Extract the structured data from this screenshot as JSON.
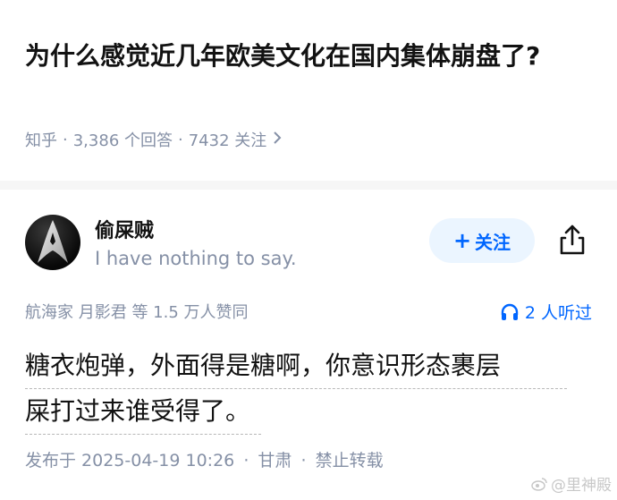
{
  "question": {
    "title": "为什么感觉近几年欧美文化在国内集体崩盘了?",
    "site": "知乎",
    "answer_count": "3,386 个回答",
    "follower_count": "7432 关注",
    "chevron_icon": "chevron-right-icon"
  },
  "author": {
    "name": "偷屎贼",
    "bio": "I have nothing to say.",
    "avatar_icon": "starfleet-insignia-avatar"
  },
  "actions": {
    "follow_label": "关注",
    "follow_plus": "+",
    "share_icon": "share-icon"
  },
  "upvote_line": "航海家 月影君 等 1.5 万人赞同",
  "listen": {
    "icon": "headphones-icon",
    "label": "2 人听过"
  },
  "answer": {
    "line1": "糖衣炮弹，外面得是糖啊，你意识形态裹层",
    "line2": "屎打过来谁受得了。"
  },
  "publish": {
    "text": "发布于 2025-04-19 10:26",
    "region": "甘肃",
    "license": "禁止转载"
  },
  "watermark": {
    "text": "@里神殿"
  },
  "colors": {
    "accent": "#0066ff",
    "accent_bg": "#ebf5ff",
    "muted": "#8590a6",
    "text": "#121212"
  }
}
